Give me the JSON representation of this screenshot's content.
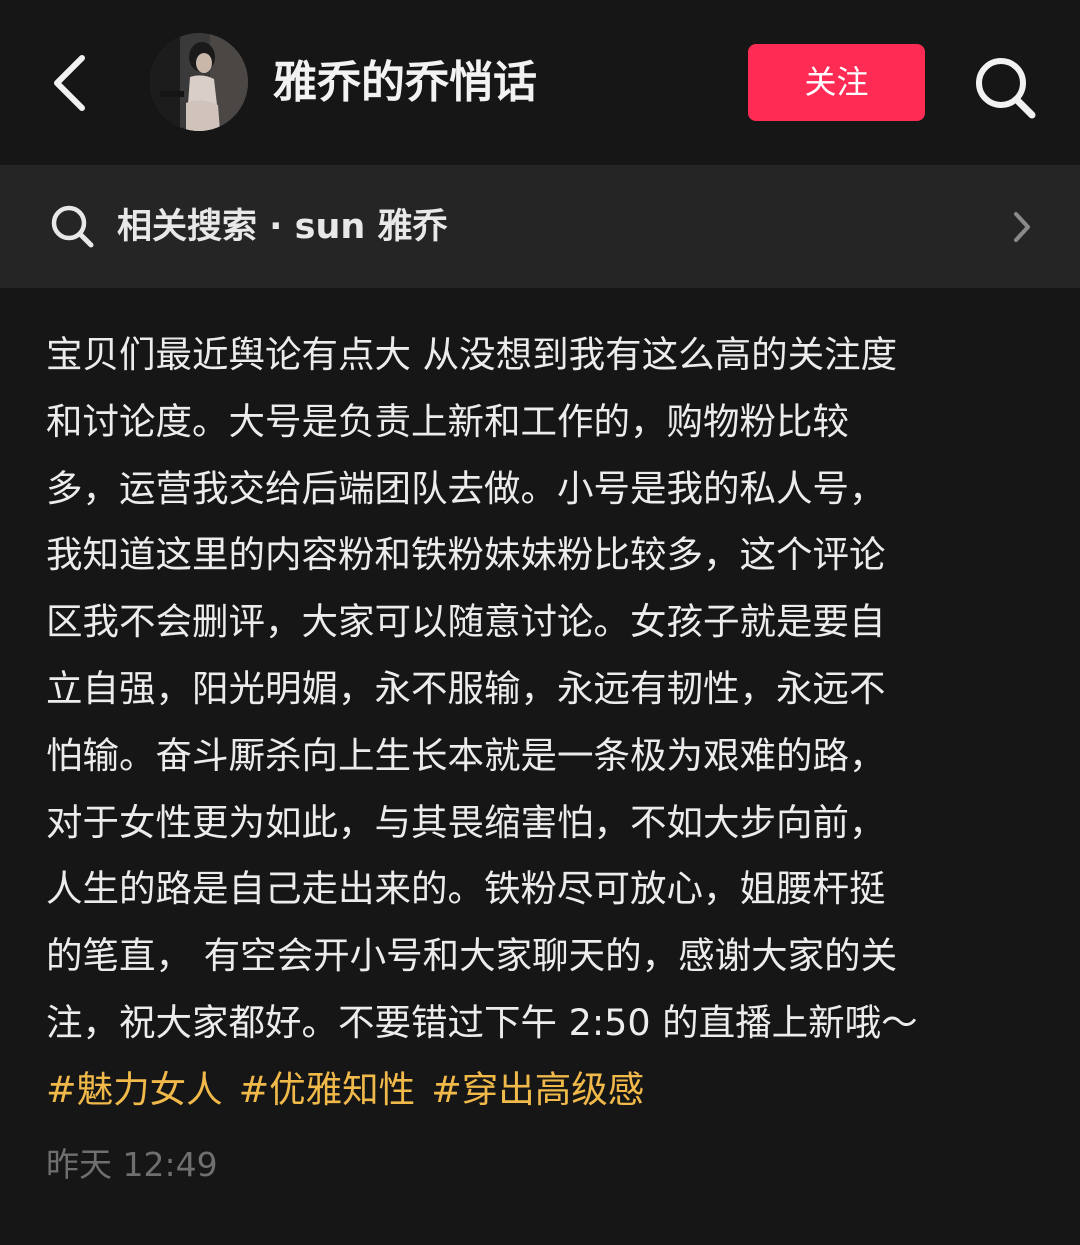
{
  "header": {
    "back_icon": "chevron-left-icon",
    "title": "雅乔的乔悄话",
    "follow_label": "关注",
    "search_icon": "search-icon"
  },
  "related_search": {
    "label": "相关搜索 · sun 雅乔",
    "icon": "search-icon",
    "chevron": "chevron-right-icon"
  },
  "post": {
    "lines": [
      "宝贝们最近舆论有点大 从没想到我有这么高的关注度",
      "和讨论度。大号是负责上新和工作的，购物粉比较",
      "多，运营我交给后端团队去做。小号是我的私人号，",
      "我知道这里的内容粉和铁粉妹妹粉比较多，这个评论",
      "区我不会删评，大家可以随意讨论。女孩子就是要自",
      "立自强，阳光明媚，永不服输，永远有韧性，永远不",
      "怕输。奋斗厮杀向上生长本就是一条极为艰难的路，",
      "对于女性更为如此，与其畏缩害怕，不如大步向前，",
      "人生的路是自己走出来的。铁粉尽可放心，姐腰杆挺",
      "的笔直， 有空会开小号和大家聊天的，感谢大家的关",
      "注，祝大家都好。不要错过下午 2:50 的直播上新哦～"
    ],
    "hashtags": [
      "#魅力女人",
      "#优雅知性",
      "#穿出高级感"
    ],
    "timestamp": "昨天 12:49"
  },
  "colors": {
    "background": "#161616",
    "related_bar": "#252525",
    "follow_button": "#fe2c55",
    "hashtag": "#f0b94a",
    "timestamp": "#6f6f6f"
  }
}
